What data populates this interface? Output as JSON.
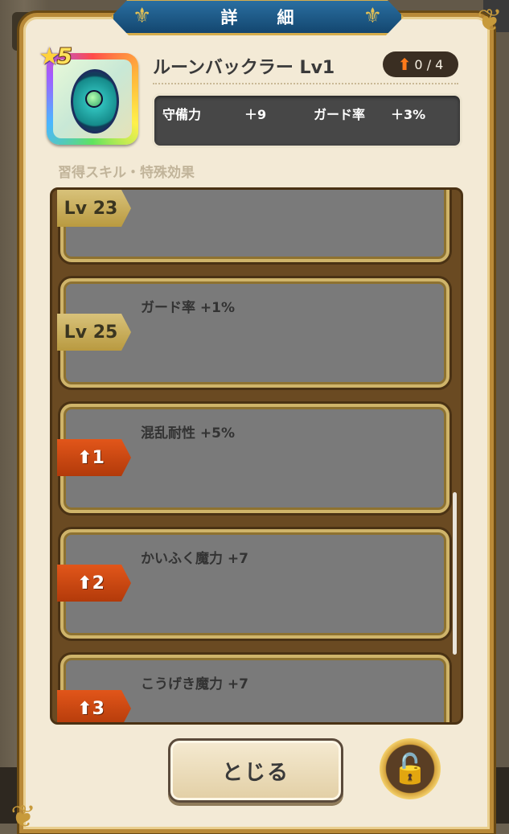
{
  "window": {
    "title": "詳　細"
  },
  "item": {
    "name": "ルーンバックラー Lv1",
    "rarity": "5",
    "upgrade_count": "0 / 4",
    "icon": "rune-buckler-shield-icon"
  },
  "stats": [
    {
      "label": "守備力",
      "value": "＋9"
    },
    {
      "label": "ガード率",
      "value": "＋3%"
    }
  ],
  "section_label": "習得スキル・特殊効果",
  "skills": [
    {
      "tag": "Lv 23",
      "tag_type": "level",
      "text": ""
    },
    {
      "tag": "Lv 25",
      "tag_type": "level",
      "text": "ガード率 +1%"
    },
    {
      "tag": "1",
      "tag_type": "upgrade",
      "text": "混乱耐性 +5%"
    },
    {
      "tag": "2",
      "tag_type": "upgrade",
      "text": "かいふく魔力 +7"
    },
    {
      "tag": "3",
      "tag_type": "upgrade",
      "text": "こうげき魔力 +7"
    }
  ],
  "buttons": {
    "close": "とじる",
    "lock": "lock-icon"
  },
  "colors": {
    "accent_gold": "#c79a3b",
    "banner_blue": "#13466f",
    "upgrade_orange": "#e2561a",
    "panel_bg": "#f3ead6"
  }
}
